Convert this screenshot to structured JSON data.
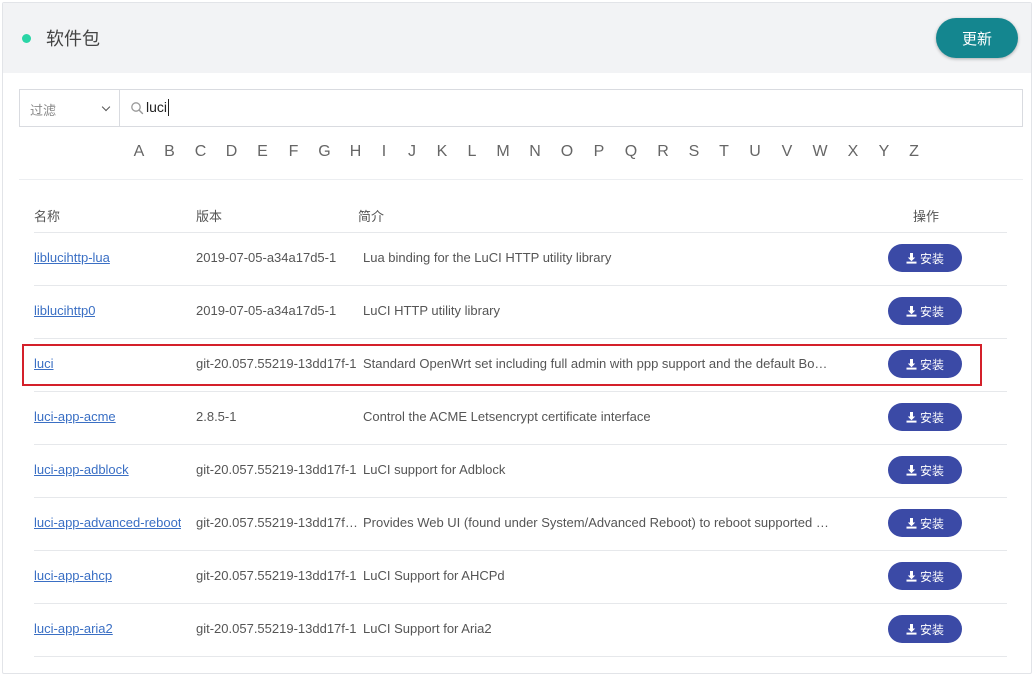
{
  "header": {
    "title": "软件包",
    "refresh_label": "更新"
  },
  "filter": {
    "select_label": "过滤",
    "search_value": "luci"
  },
  "alphabet": [
    "A",
    "B",
    "C",
    "D",
    "E",
    "F",
    "G",
    "H",
    "I",
    "J",
    "K",
    "L",
    "M",
    "N",
    "O",
    "P",
    "Q",
    "R",
    "S",
    "T",
    "U",
    "V",
    "W",
    "X",
    "Y",
    "Z"
  ],
  "table": {
    "headers": {
      "name": "名称",
      "version": "版本",
      "description": "简介",
      "action": "操作"
    },
    "install_label": "安装",
    "rows": [
      {
        "name": "liblucihttp-lua",
        "version": "2019-07-05-a34a17d5-1",
        "description": "Lua binding for the LuCI HTTP utility library"
      },
      {
        "name": "liblucihttp0",
        "version": "2019-07-05-a34a17d5-1",
        "description": "LuCI HTTP utility library"
      },
      {
        "name": "luci",
        "version": "git-20.057.55219-13dd17f-1",
        "description": "Standard OpenWrt set including full admin with ppp support and the default Bo…"
      },
      {
        "name": "luci-app-acme",
        "version": "2.8.5-1",
        "description": "Control the ACME Letsencrypt certificate interface"
      },
      {
        "name": "luci-app-adblock",
        "version": "git-20.057.55219-13dd17f-1",
        "description": "LuCI support for Adblock"
      },
      {
        "name": "luci-app-advanced-reboot",
        "version": "git-20.057.55219-13dd17f…",
        "description": "Provides Web UI (found under System/Advanced Reboot) to reboot supported …"
      },
      {
        "name": "luci-app-ahcp",
        "version": "git-20.057.55219-13dd17f-1",
        "description": "LuCI Support for AHCPd"
      },
      {
        "name": "luci-app-aria2",
        "version": "git-20.057.55219-13dd17f-1",
        "description": "LuCI Support for Aria2"
      }
    ]
  },
  "highlighted_row": "luci",
  "colors": {
    "accent": "#14868f",
    "install_button": "#3b4aa6",
    "highlight": "#d4202a",
    "status_dot": "#2ad5a6",
    "link": "#3a6fc4"
  }
}
